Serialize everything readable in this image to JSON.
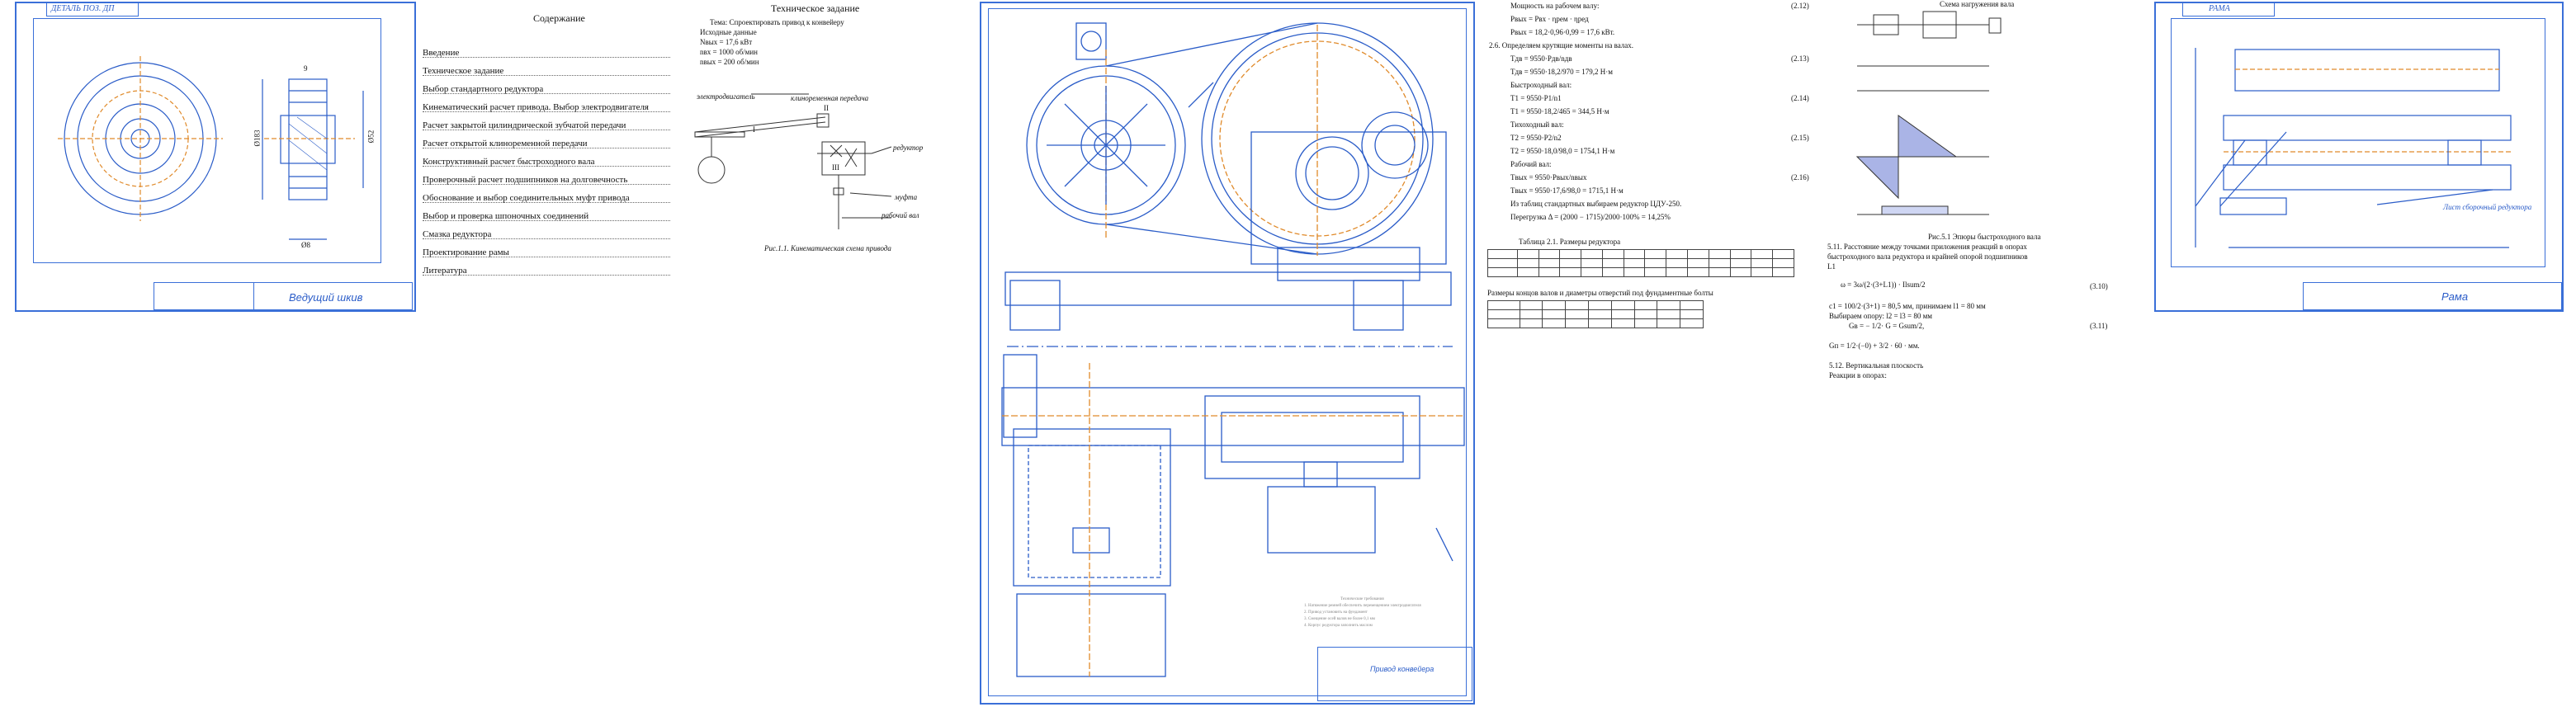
{
  "sheet1": {
    "corner_label": "ДЕТАЛЬ ПОЗ. ДП",
    "stamp_title": "Ведущий шкив",
    "dims": {
      "diameter": "Ø183",
      "hub": "Ø52",
      "width_bottom": "Ø8",
      "width_top": "9"
    }
  },
  "contents": {
    "title": "Содержание",
    "items": [
      "Введение",
      "Техническое задание",
      "Выбор стандартного редуктора",
      "Кинематический расчет привода. Выбор электродвигателя",
      "Расчет закрытой цилиндрической зубчатой передачи",
      "Расчет открытой клиноременной передачи",
      "Конструктивный расчет быстроходного вала",
      "Проверочный расчет подшипников на долговечность",
      "Обоснование и выбор соединительных муфт привода",
      "Выбор и проверка шпоночных соединений",
      "Смазка редуктора",
      "Проектирование рамы",
      "Литература"
    ]
  },
  "task": {
    "title": "Техническое задание",
    "subtitle": "Тема: Спроектировать привод к конвейеру",
    "data_label": "Исходные данные",
    "params": [
      "Nвых = 17,6 кВт",
      "nвх = 1000 об/мин",
      "nвых = 200 об/мин"
    ],
    "labels": [
      "электродвигатель",
      "клиноременная передача",
      "редуктор",
      "муфта",
      "рабочий вал"
    ],
    "marks": [
      "I",
      "II",
      "III"
    ],
    "caption": "Рис.1.1. Кинематическая схема привода"
  },
  "assembly": {
    "spec_title": "Технические требования",
    "notes": [
      "1. Натяжение ремней обеспечить перемещением электродвигателя",
      "2. Привод установить на фундамент",
      "3. Смещение осей валов не более 0,1 мм",
      "4. Корпус редуктора заполнить маслом"
    ],
    "stamp_title": "Привод конвейера"
  },
  "calc": {
    "lines": [
      {
        "text": "Мощность на рабочем валу:",
        "eq": "(2.12)"
      },
      {
        "text": "Pвых = Pвх · ηрем · ηред",
        "eq": ""
      },
      {
        "text": "Pвых = 18,2·0,96·0,99 = 17,6 кВт.",
        "eq": ""
      },
      {
        "text": "2.6. Определяем крутящие моменты на валах.",
        "eq": ""
      },
      {
        "text": "Tдв = 9550·Pдв/nдв",
        "eq": "(2.13)"
      },
      {
        "text": "Tдв = 9550·18,2/970 = 179,2 Н·м",
        "eq": ""
      },
      {
        "text": "Быстроходный вал:",
        "eq": ""
      },
      {
        "text": "T1 = 9550·P1/n1",
        "eq": "(2.14)"
      },
      {
        "text": "T1 = 9550·18,2/465 = 344,5 Н·м",
        "eq": ""
      },
      {
        "text": "Тихоходный вал:",
        "eq": ""
      },
      {
        "text": "T2 = 9550·P2/n2",
        "eq": "(2.15)"
      },
      {
        "text": "T2 = 9550·18,0/98,0 = 1754,1 Н·м",
        "eq": ""
      },
      {
        "text": "Рабочий вал:",
        "eq": ""
      },
      {
        "text": "Tвых = 9550·Pвых/nвых",
        "eq": "(2.16)"
      },
      {
        "text": "Tвых = 9550·17,6/98,0 = 1715,1 Н·м",
        "eq": ""
      },
      {
        "text": "Из таблиц стандартных выбираем редуктор ЦДУ-250.",
        "eq": ""
      },
      {
        "text": "Перегрузка Δ = (2000 − 1715)/2000·100% = 14,25%",
        "eq": ""
      }
    ],
    "table_caption": "Таблица 2.1. Размеры редуктора",
    "table_caption2": "Размеры концов валов и диаметры отверстий под фундаментные болты"
  },
  "shaft": {
    "title": "Схема нагружения вала",
    "caption": "Рис.5.1 Эпюры быстроходного вала",
    "lines": [
      "5.11. Расстояние между точками приложения реакций в опорах",
      "быстроходного вала редуктора и крайней опорой подшипников",
      "L1",
      "ω = 3ω/(2·(3+L1)) · Ilsum/2",
      "c1 = 100/2·(3+1) = 80,5 мм, принимаем l1 = 80 мм",
      "Выбираем опору: l2 = l3 = 80 мм",
      "Gв = − 1/2· G = Gsum/2,",
      "Gп = 1/2·(−0) + 3/2 · 60 · мм.",
      "5.12. Вертикальная плоскость",
      "Реакции в опорах:"
    ],
    "eqs": [
      "(3.10)",
      "(3.11)"
    ]
  },
  "sheet_last": {
    "corner_label": "РАМА",
    "stamp_title": "Рама",
    "label": "Лист сборочный редуктора"
  }
}
